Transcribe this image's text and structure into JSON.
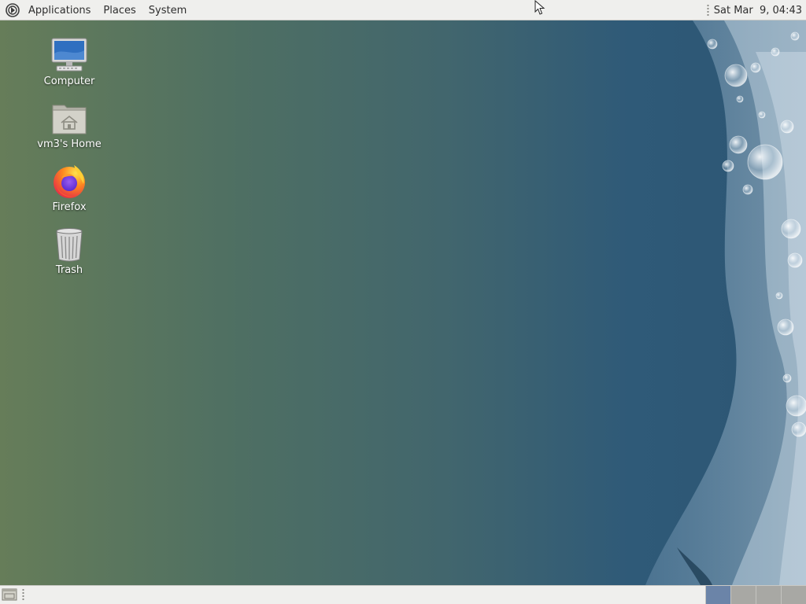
{
  "top_panel": {
    "menus": [
      {
        "label": "Applications",
        "icon": "distro-logo-icon"
      },
      {
        "label": "Places"
      },
      {
        "label": "System"
      }
    ],
    "clock": "Sat Mar  9, 04:43"
  },
  "desktop": {
    "icons": [
      {
        "label": "Computer",
        "icon": "computer-icon"
      },
      {
        "label": "vm3's Home",
        "icon": "home-folder-icon"
      },
      {
        "label": "Firefox",
        "icon": "firefox-icon"
      },
      {
        "label": "Trash",
        "icon": "trash-icon"
      }
    ]
  },
  "bottom_panel": {
    "show_desktop_icon": "show-desktop-icon",
    "workspaces": 4,
    "active_workspace": 1
  },
  "colors": {
    "panel_bg": "#efefed",
    "wallpaper_left": "#667d59",
    "wallpaper_right": "#2c5573",
    "active_workspace": "#6b84a8"
  }
}
